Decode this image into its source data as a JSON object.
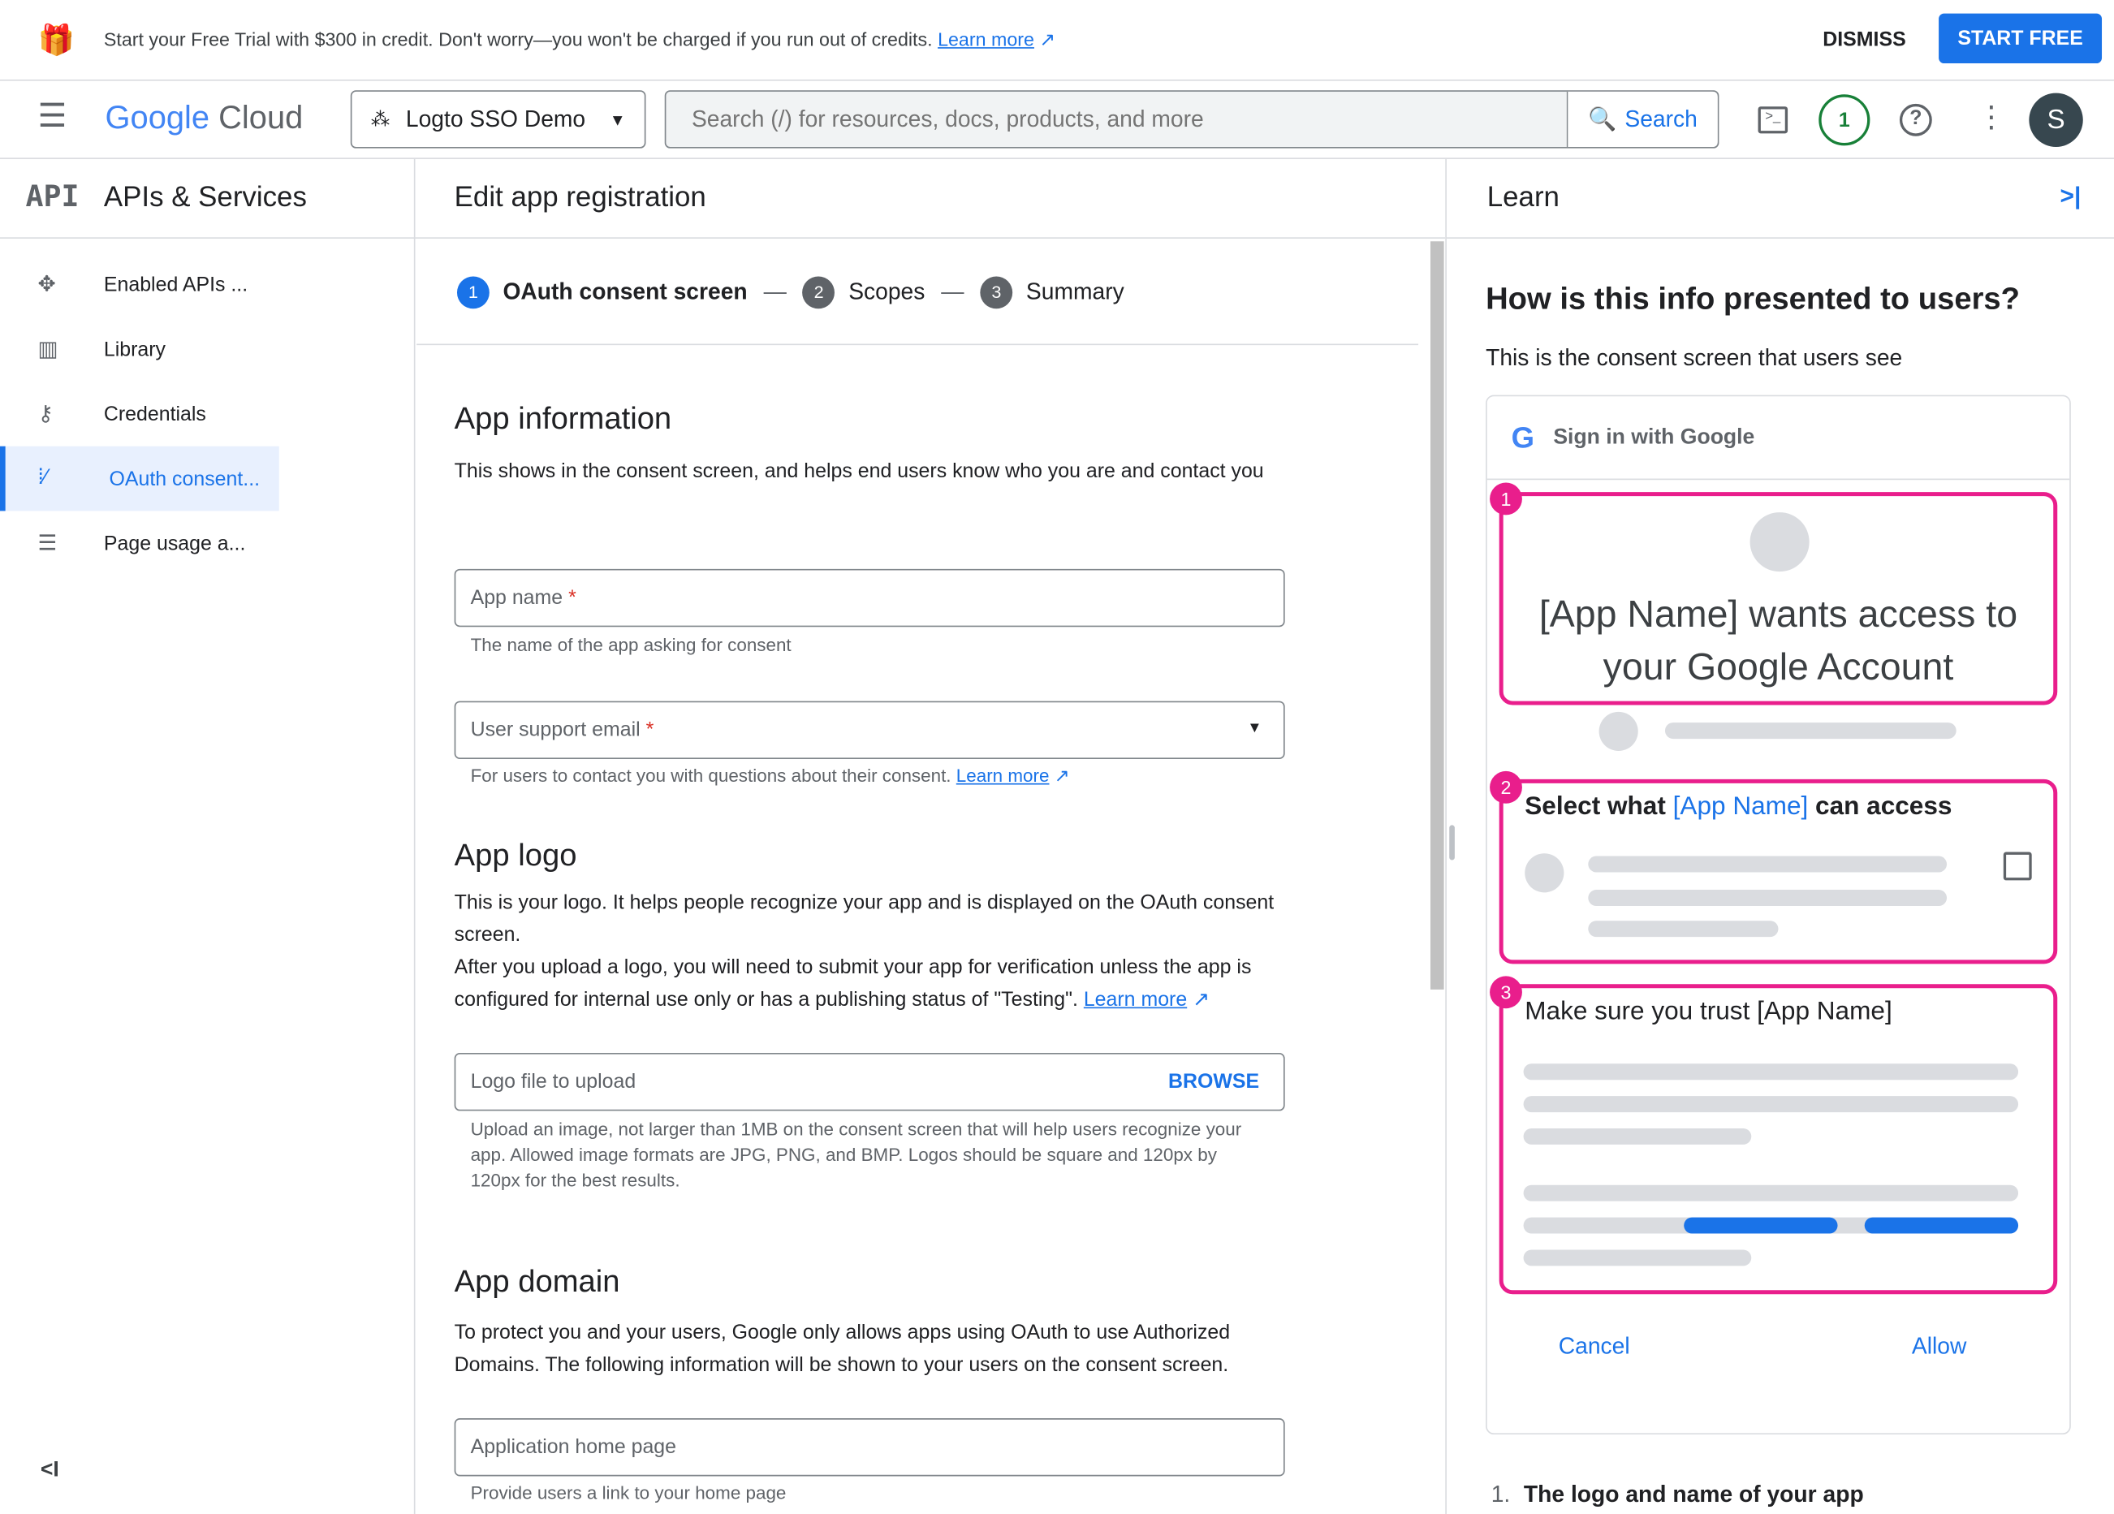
{
  "banner": {
    "text": "Start your Free Trial with $300 in credit. Don't worry—you won't be charged if you run out of credits.",
    "learn_more": "Learn more",
    "dismiss": "DISMISS",
    "start_free": "START FREE"
  },
  "header": {
    "logo_google": "Google",
    "logo_cloud": "Cloud",
    "project": "Logto SSO Demo",
    "search_placeholder": "Search (/) for resources, docs, products, and more",
    "search_button": "Search",
    "notifications_count": "1",
    "avatar_initial": "S"
  },
  "sidebar": {
    "product_icon": "API",
    "title": "APIs & Services",
    "items": [
      {
        "label": "Enabled APIs ...",
        "icon": "enabled-apis-icon"
      },
      {
        "label": "Library",
        "icon": "library-icon"
      },
      {
        "label": "Credentials",
        "icon": "key-icon"
      },
      {
        "label": "OAuth consent...",
        "icon": "oauth-consent-icon",
        "active": true
      },
      {
        "label": "Page usage a...",
        "icon": "page-usage-icon"
      }
    ]
  },
  "main": {
    "title": "Edit app registration",
    "steps": [
      {
        "num": "1",
        "label": "OAuth consent screen",
        "active": true
      },
      {
        "num": "2",
        "label": "Scopes"
      },
      {
        "num": "3",
        "label": "Summary"
      }
    ],
    "app_info": {
      "heading": "App information",
      "desc": "This shows in the consent screen, and helps end users know who you are and contact you",
      "app_name_label": "App name",
      "app_name_hint": "The name of the app asking for consent",
      "email_label": "User support email",
      "email_hint": "For users to contact you with questions about their consent.",
      "learn_more": "Learn more"
    },
    "app_logo": {
      "heading": "App logo",
      "desc1": "This is your logo. It helps people recognize your app and is displayed on the OAuth consent screen.",
      "desc2": "After you upload a logo, you will need to submit your app for verification unless the app is configured for internal use only or has a publishing status of \"Testing\".",
      "learn_more": "Learn more",
      "field_label": "Logo file to upload",
      "browse": "BROWSE",
      "hint": "Upload an image, not larger than 1MB on the consent screen that will help users recognize your app. Allowed image formats are JPG, PNG, and BMP. Logos should be square and 120px by 120px for the best results."
    },
    "app_domain": {
      "heading": "App domain",
      "desc": "To protect you and your users, Google only allows apps using OAuth to use Authorized Domains. The following information will be shown to your users on the consent screen.",
      "home_label": "Application home page",
      "home_hint": "Provide users a link to your home page"
    }
  },
  "learn": {
    "title": "Learn",
    "heading": "How is this info presented to users?",
    "sub": "This is the consent screen that users see",
    "sign_in": "Sign in with Google",
    "box1_num": "1",
    "box1_text": "[App Name] wants access to your Google Account",
    "box2_num": "2",
    "box2_pre": "Select what ",
    "box2_app": "[App Name]",
    "box2_post": " can access",
    "box3_num": "3",
    "box3_text": "Make sure you trust [App Name]",
    "cancel": "Cancel",
    "allow": "Allow",
    "list1_num": "1.",
    "list1": "The logo and name of your app"
  },
  "colors": {
    "accent": "#1a73e8",
    "highlight": "#e91e8c"
  }
}
